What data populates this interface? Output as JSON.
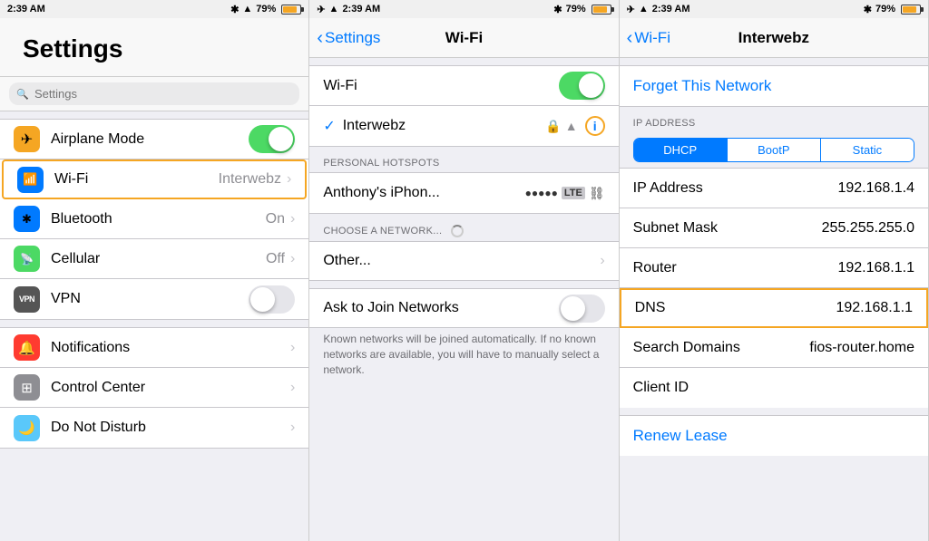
{
  "panel1": {
    "status": {
      "time": "2:39 AM",
      "signal": "●●●",
      "wifi": "wifi",
      "bluetooth": "BT",
      "battery_pct": "79%"
    },
    "title": "Settings",
    "search_placeholder": "Settings",
    "rows": [
      {
        "id": "airplane",
        "icon": "✈",
        "icon_color": "orange",
        "label": "Airplane Mode",
        "value": "",
        "has_toggle": true,
        "toggle_on": true,
        "has_chevron": false,
        "highlighted": false
      },
      {
        "id": "wifi",
        "icon": "📶",
        "icon_color": "blue",
        "label": "Wi-Fi",
        "value": "Interwebz",
        "has_toggle": false,
        "has_chevron": true,
        "highlighted": true
      },
      {
        "id": "bluetooth",
        "icon": "🔵",
        "icon_color": "blue",
        "label": "Bluetooth",
        "value": "On",
        "has_toggle": false,
        "has_chevron": true,
        "highlighted": false
      },
      {
        "id": "cellular",
        "icon": "📡",
        "icon_color": "green",
        "label": "Cellular",
        "value": "Off",
        "has_toggle": false,
        "has_chevron": true,
        "highlighted": false
      },
      {
        "id": "vpn",
        "icon": "VPN",
        "icon_color": "dark",
        "label": "VPN",
        "value": "",
        "has_toggle": false,
        "toggle_on": false,
        "has_toggle_small": true,
        "has_chevron": false,
        "highlighted": false
      }
    ],
    "rows2": [
      {
        "id": "notifications",
        "icon": "🔔",
        "icon_color": "red",
        "label": "Notifications",
        "value": "",
        "has_chevron": true
      },
      {
        "id": "control-center",
        "icon": "⚙",
        "icon_color": "gray",
        "label": "Control Center",
        "value": "",
        "has_chevron": true
      },
      {
        "id": "do-not-disturb",
        "icon": "🌙",
        "icon_color": "teal",
        "label": "Do Not Disturb",
        "value": "",
        "has_chevron": true
      }
    ]
  },
  "panel2": {
    "status": {
      "time": "2:39 AM",
      "battery_pct": "79%"
    },
    "nav_back": "Settings",
    "nav_title": "Wi-Fi",
    "wifi_label": "Wi-Fi",
    "wifi_on": true,
    "network_name": "Interwebz",
    "personal_hotspots_header": "PERSONAL HOTSPOTS",
    "hotspot_name": "Anthony's iPhon...",
    "choose_network_header": "CHOOSE A NETWORK...",
    "other_label": "Other...",
    "ask_label": "Ask to Join Networks",
    "ask_note": "Known networks will be joined automatically. If no known networks are available, you will have to manually select a network."
  },
  "panel3": {
    "status": {
      "time": "2:39 AM",
      "battery_pct": "79%"
    },
    "nav_back": "Wi-Fi",
    "nav_title": "Interwebz",
    "forget_label": "Forget This Network",
    "ip_header": "IP ADDRESS",
    "seg_dhcp": "DHCP",
    "seg_bootp": "BootP",
    "seg_static": "Static",
    "ip_rows": [
      {
        "label": "IP Address",
        "value": "192.168.1.4",
        "highlighted": false
      },
      {
        "label": "Subnet Mask",
        "value": "255.255.255.0",
        "highlighted": false
      },
      {
        "label": "Router",
        "value": "192.168.1.1",
        "highlighted": false
      },
      {
        "label": "DNS",
        "value": "192.168.1.1",
        "highlighted": true
      },
      {
        "label": "Search Domains",
        "value": "fios-router.home",
        "highlighted": false
      },
      {
        "label": "Client ID",
        "value": "",
        "highlighted": false
      }
    ],
    "renew_label": "Renew Lease"
  }
}
